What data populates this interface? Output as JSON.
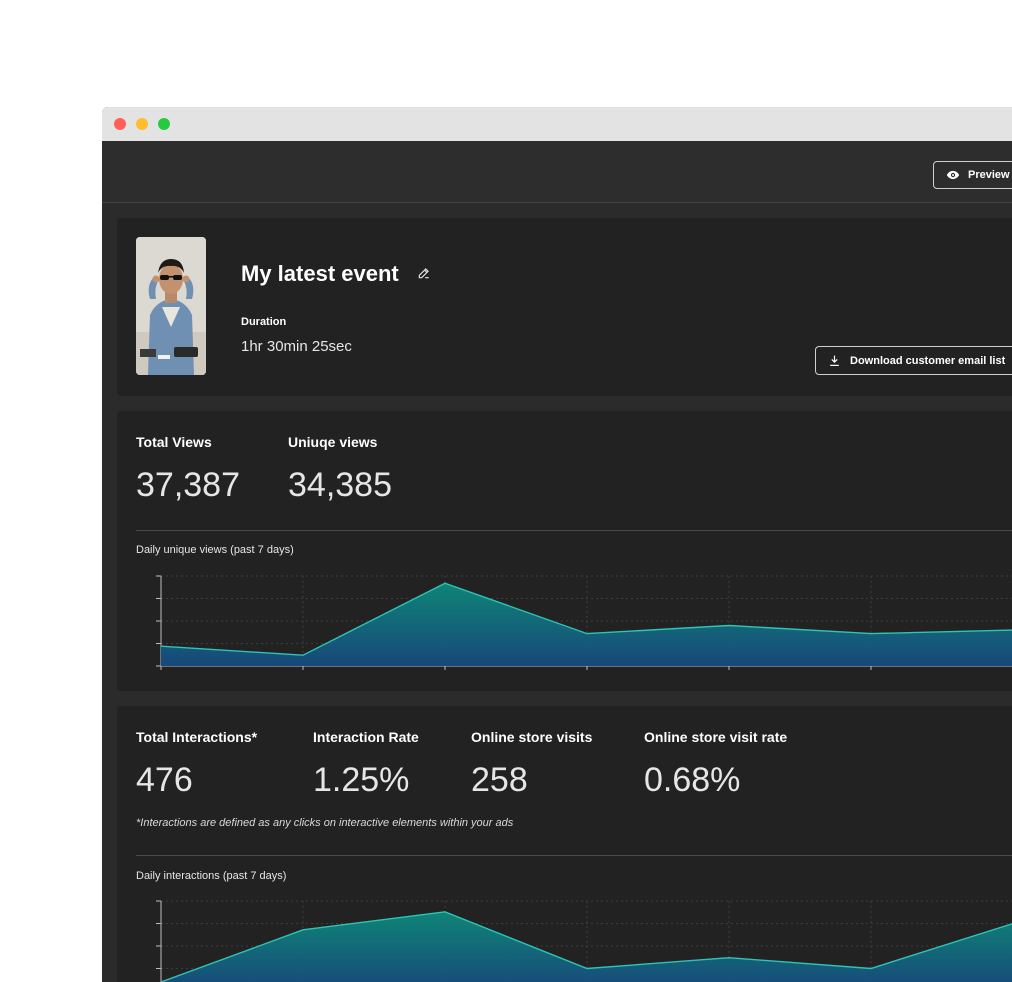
{
  "toolbar": {
    "preview_label": "Preview"
  },
  "event": {
    "title": "My latest event",
    "duration_label": "Duration",
    "duration_value": "1hr 30min 25sec",
    "download_label": "Download customer email list"
  },
  "views": {
    "total_label": "Total Views",
    "total_value": "37,387",
    "unique_label": "Uniuqe views",
    "unique_value": "34,385",
    "chart_label": "Daily unique views (past 7 days)"
  },
  "interactions": {
    "total_label": "Total Interactions*",
    "total_value": "476",
    "rate_label": "Interaction Rate",
    "rate_value": "1.25%",
    "visits_label": "Online store visits",
    "visits_value": "258",
    "visit_rate_label": "Online store visit rate",
    "visit_rate_value": "0.68%",
    "footnote": "*Interactions are defined as any clicks on interactive elements within your ads",
    "chart_label": "Daily interactions (past 7 days)"
  },
  "colors": {
    "line": "#2ec4b6",
    "fill_top": "#0d8a7a",
    "fill_bottom": "#17497f"
  },
  "chart_data": [
    {
      "type": "area",
      "x": [
        1,
        2,
        3,
        4,
        5,
        6,
        7
      ],
      "values": [
        22,
        12,
        92,
        36,
        45,
        36,
        40
      ],
      "ylim": [
        0,
        100
      ]
    },
    {
      "type": "area",
      "x": [
        1,
        2,
        3,
        4,
        5,
        6,
        7
      ],
      "values": [
        10,
        68,
        88,
        25,
        37,
        25,
        75
      ],
      "ylim": [
        0,
        100
      ]
    }
  ]
}
